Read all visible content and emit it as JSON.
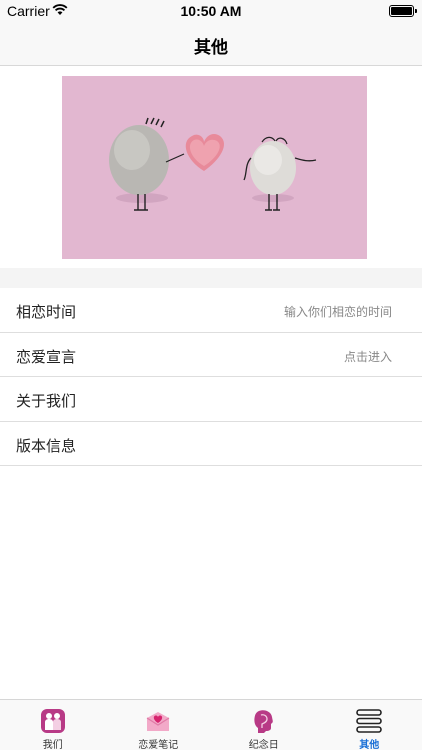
{
  "status_bar": {
    "carrier": "Carrier",
    "time": "10:50 AM"
  },
  "nav": {
    "title": "其他"
  },
  "banner": {
    "image": "two pebbles with heart on pink background"
  },
  "menu": [
    {
      "label": "相恋时间",
      "detail": "输入你们相恋的时间"
    },
    {
      "label": "恋爱宣言",
      "detail": "点击进入"
    },
    {
      "label": "关于我们",
      "detail": ""
    },
    {
      "label": "版本信息",
      "detail": ""
    }
  ],
  "tabs": [
    {
      "label": "我们",
      "icon": "couple-icon",
      "active": false
    },
    {
      "label": "恋爱笔记",
      "icon": "love-letter-icon",
      "active": false
    },
    {
      "label": "纪念日",
      "icon": "face-silhouette-icon",
      "active": false
    },
    {
      "label": "其他",
      "icon": "menu-lines-icon",
      "active": true
    }
  ],
  "colors": {
    "accent": "#1a6fd6",
    "banner_bg": "#e2b7d0"
  }
}
